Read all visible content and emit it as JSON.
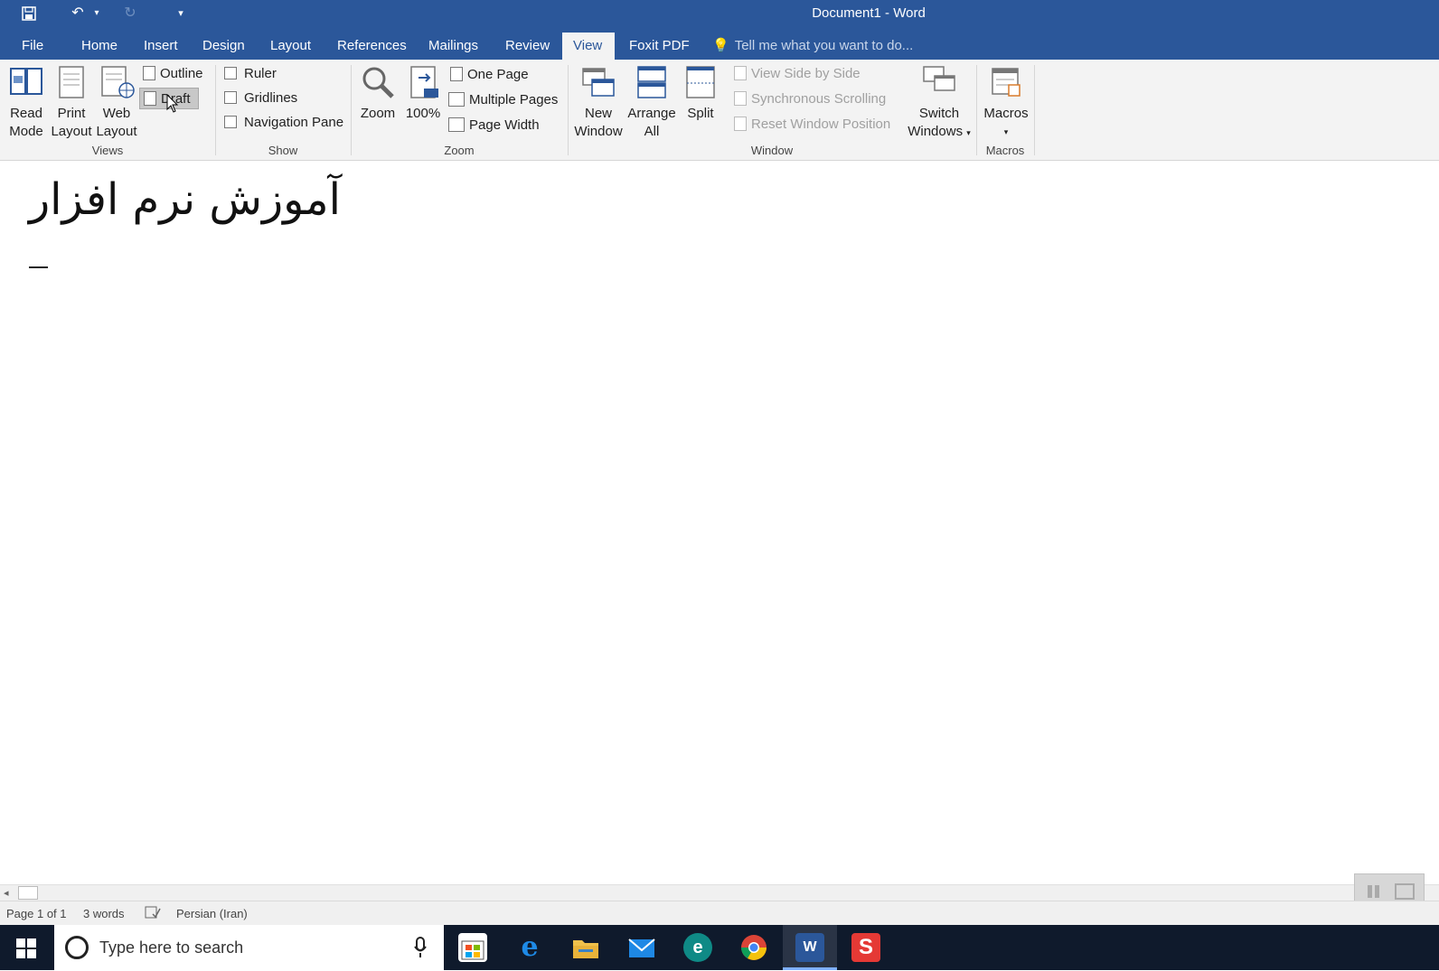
{
  "app": {
    "title": "Document1 - Word"
  },
  "quick_access": {
    "save_icon": "save-icon",
    "undo_icon": "undo-icon",
    "redo_icon": "redo-icon",
    "customize_icon": "customize-icon"
  },
  "tabs": [
    {
      "label": "File"
    },
    {
      "label": "Home"
    },
    {
      "label": "Insert"
    },
    {
      "label": "Design"
    },
    {
      "label": "Layout"
    },
    {
      "label": "References"
    },
    {
      "label": "Mailings"
    },
    {
      "label": "Review"
    },
    {
      "label": "View"
    },
    {
      "label": "Foxit PDF"
    }
  ],
  "active_tab": "View",
  "tell_me": {
    "placeholder": "Tell me what you want to do..."
  },
  "ribbon": {
    "views": {
      "label": "Views",
      "read_mode": [
        "Read",
        "Mode"
      ],
      "print_layout": [
        "Print",
        "Layout"
      ],
      "web_layout": [
        "Web",
        "Layout"
      ],
      "outline": "Outline",
      "draft": "Draft"
    },
    "show": {
      "label": "Show",
      "ruler": "Ruler",
      "gridlines": "Gridlines",
      "navigation_pane": "Navigation Pane"
    },
    "zoom": {
      "label": "Zoom",
      "zoom": "Zoom",
      "hundred": "100%",
      "one_page": "One Page",
      "multiple_pages": "Multiple Pages",
      "page_width": "Page Width"
    },
    "window": {
      "label": "Window",
      "new_window": [
        "New",
        "Window"
      ],
      "arrange_all": [
        "Arrange",
        "All"
      ],
      "split": "Split",
      "view_side_by_side": "View Side by Side",
      "synchronous_scrolling": "Synchronous Scrolling",
      "reset_window_position": "Reset Window Position",
      "switch_windows": [
        "Switch",
        "Windows"
      ]
    },
    "macros": {
      "label": "Macros",
      "macros": "Macros"
    }
  },
  "document": {
    "heading": "آموزش نرم افزار"
  },
  "status": {
    "page": "Page 1 of 1",
    "words": "3 words",
    "language": "Persian (Iran)"
  },
  "taskbar": {
    "search_placeholder": "Type here to search"
  },
  "colors": {
    "word_blue": "#2b579a",
    "ribbon_bg": "#f3f3f3",
    "taskbar": "#0f1a2c"
  }
}
